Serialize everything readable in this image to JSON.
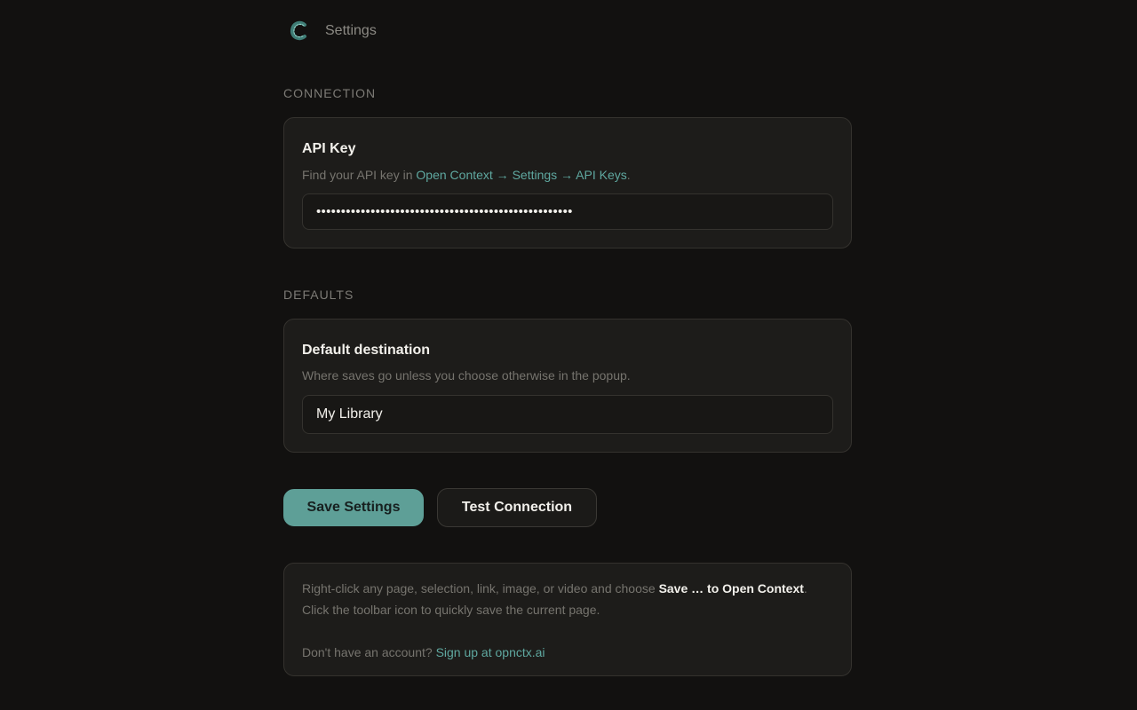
{
  "header": {
    "title": "Settings",
    "logo_icon": "open-context-logo"
  },
  "connection": {
    "section_label": "CONNECTION",
    "api_key": {
      "title": "API Key",
      "desc_prefix": "Find your API key in ",
      "desc_link": "Open Context → Settings → API Keys",
      "desc_suffix": ".",
      "value": "••••••••••••••••••••••••••••••••••••••••••••••••••••"
    }
  },
  "defaults": {
    "section_label": "DEFAULTS",
    "destination": {
      "title": "Default destination",
      "desc": "Where saves go unless you choose otherwise in the popup.",
      "value": "My Library"
    }
  },
  "actions": {
    "save_label": "Save Settings",
    "test_label": "Test Connection"
  },
  "info": {
    "line1_prefix": "Right-click any page, selection, link, image, or video and choose ",
    "line1_bold": "Save … to Open Context",
    "line1_suffix": ". Click the toolbar icon to quickly save the current page.",
    "line2_prefix": "Don't have an account? ",
    "line2_link": "Sign up at opnctx.ai"
  },
  "colors": {
    "accent": "#5e9f97",
    "link": "#5fa8a0",
    "background": "#121110",
    "card": "#1d1c1a"
  }
}
